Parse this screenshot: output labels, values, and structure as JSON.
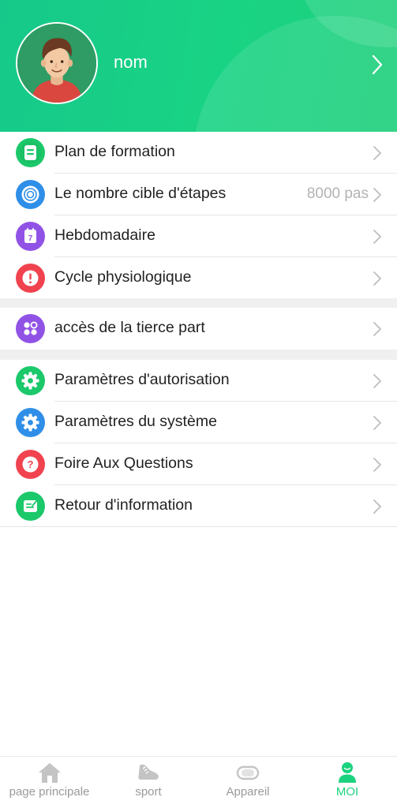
{
  "profile": {
    "name": "nom"
  },
  "menu_groups": [
    {
      "items": [
        {
          "label": "Plan de formation",
          "value": "",
          "icon": "training-plan-icon",
          "color": "#1bc86a"
        },
        {
          "label": "Le nombre cible d'étapes",
          "value": "8000 pas",
          "icon": "target-steps-icon",
          "color": "#2f8fe8"
        },
        {
          "label": "Hebdomadaire",
          "value": "",
          "icon": "weekly-calendar-icon",
          "color": "#9153e6"
        },
        {
          "label": "Cycle physiologique",
          "value": "",
          "icon": "alert-icon",
          "color": "#f0434f"
        }
      ]
    },
    {
      "items": [
        {
          "label": "accès de la tierce part",
          "value": "",
          "icon": "third-party-apps-icon",
          "color": "#9153e6"
        }
      ]
    },
    {
      "items": [
        {
          "label": "Paramètres d'autorisation",
          "value": "",
          "icon": "permission-gear-icon",
          "color": "#1bc86a"
        },
        {
          "label": "Paramètres du système",
          "value": "",
          "icon": "system-gear-icon",
          "color": "#2f8fe8"
        },
        {
          "label": "Foire Aux Questions",
          "value": "",
          "icon": "question-icon",
          "color": "#f0434f"
        },
        {
          "label": "Retour d'information",
          "value": "",
          "icon": "feedback-icon",
          "color": "#1bc86a"
        }
      ]
    }
  ],
  "tabbar": {
    "tabs": [
      {
        "label": "page principale",
        "icon": "home-icon",
        "active": false
      },
      {
        "label": "sport",
        "icon": "shoe-icon",
        "active": false
      },
      {
        "label": "Appareil",
        "icon": "band-device-icon",
        "active": false
      },
      {
        "label": "MOI",
        "icon": "person-icon",
        "active": true
      }
    ]
  },
  "colors": {
    "header_green": "#16c98a",
    "active_tab": "#1bd37f",
    "chevron": "#bdbdbd"
  }
}
